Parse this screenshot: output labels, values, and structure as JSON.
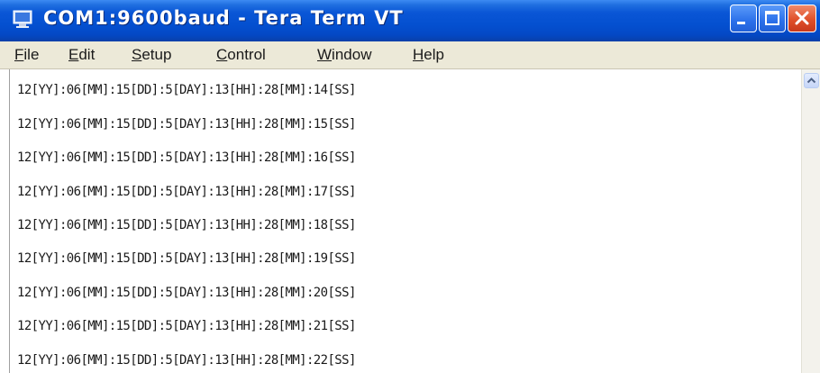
{
  "window": {
    "title": "COM1:9600baud - Tera Term VT",
    "icon": "tera-term-monitor-icon",
    "controls": [
      "minimize-icon",
      "maximize-icon",
      "close-icon"
    ]
  },
  "menu": {
    "items": [
      {
        "accel": "F",
        "rest": "ile"
      },
      {
        "accel": "E",
        "rest": "dit"
      },
      {
        "accel": "S",
        "rest": "etup"
      },
      {
        "accel": "C",
        "rest": "ontrol"
      },
      {
        "accel": "W",
        "rest": "indow"
      },
      {
        "accel": "H",
        "rest": "elp"
      }
    ]
  },
  "terminal": {
    "lines": [
      "12[YY]:06[MM]:15[DD]:5[DAY]:13[HH]:28[MM]:14[SS]",
      "12[YY]:06[MM]:15[DD]:5[DAY]:13[HH]:28[MM]:15[SS]",
      "12[YY]:06[MM]:15[DD]:5[DAY]:13[HH]:28[MM]:16[SS]",
      "12[YY]:06[MM]:15[DD]:5[DAY]:13[HH]:28[MM]:17[SS]",
      "12[YY]:06[MM]:15[DD]:5[DAY]:13[HH]:28[MM]:18[SS]",
      "12[YY]:06[MM]:15[DD]:5[DAY]:13[HH]:28[MM]:19[SS]",
      "12[YY]:06[MM]:15[DD]:5[DAY]:13[HH]:28[MM]:20[SS]",
      "12[YY]:06[MM]:15[DD]:5[DAY]:13[HH]:28[MM]:21[SS]",
      "12[YY]:06[MM]:15[DD]:5[DAY]:13[HH]:28[MM]:22[SS]"
    ]
  },
  "scrollbar": {
    "up_icon": "scroll-up-arrow-icon"
  },
  "colors": {
    "titlebar": "#0a56d6",
    "menubar": "#ece9d8",
    "terminal_bg": "#ffffff",
    "terminal_text": "#1a1a1a",
    "close_button": "#e0502a"
  }
}
